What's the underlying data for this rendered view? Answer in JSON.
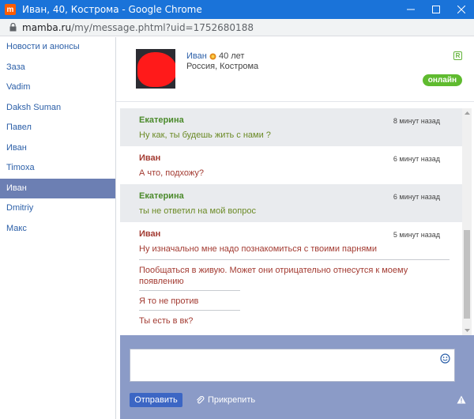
{
  "window": {
    "title": "Иван, 40, Кострома - Google Chrome",
    "app_icon_letter": "m"
  },
  "address": {
    "domain": "mamba.ru",
    "path": "/my/message.phtml?uid=1752680188"
  },
  "sidebar": {
    "items": [
      {
        "label": "Новости и анонсы"
      },
      {
        "label": "Заза"
      },
      {
        "label": "Vadim"
      },
      {
        "label": "Daksh Suman"
      },
      {
        "label": "Павел"
      },
      {
        "label": "Иван"
      },
      {
        "label": "Timoxa"
      },
      {
        "label": "Иван"
      },
      {
        "label": "Dmitriy"
      },
      {
        "label": "Макс"
      }
    ],
    "active_index": 7
  },
  "profile": {
    "name": "Иван",
    "age": "40 лет",
    "location": "Россия, Кострома",
    "badge": "R",
    "status": "онлайн"
  },
  "messages": [
    {
      "author": "Екатерина",
      "time": "8 минут назад",
      "lines": [
        "Ну как, ты будешь жить с нами ?"
      ]
    },
    {
      "author": "Иван",
      "time": "6 минут назад",
      "lines": [
        "А что, подхожу?"
      ]
    },
    {
      "author": "Екатерина",
      "time": "6 минут назад",
      "lines": [
        "ты не ответил на мой вопрос"
      ]
    },
    {
      "author": "Иван",
      "time": "5 минут назад",
      "lines": [
        "Ну изначально мне надо познакомиться с твоими парнями",
        "Пообщаться в живую. Может они отрицательно отнесутся к моему появлению",
        "Я то не против",
        "Ты есть в вк?"
      ]
    }
  ],
  "compose": {
    "send_label": "Отправить",
    "attach_label": "Прикрепить"
  },
  "colors": {
    "titlebar": "#1a73d9",
    "sidebar_active": "#6c7fb3",
    "compose_bg": "#8b9bc7",
    "send_button": "#3c66c4",
    "online_badge": "#5fbb2f",
    "female_author": "#4b8a2b",
    "male_author": "#a33b32"
  }
}
